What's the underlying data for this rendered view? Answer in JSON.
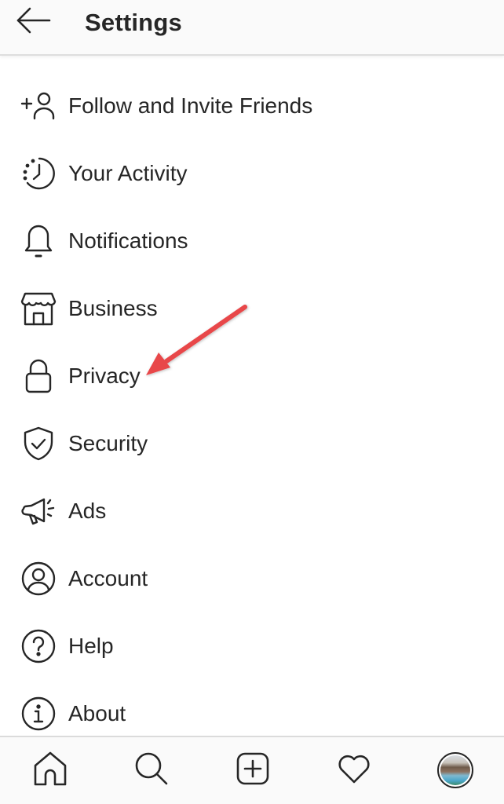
{
  "header": {
    "back_icon": "arrow-left-icon",
    "title": "Settings"
  },
  "menu": {
    "items": [
      {
        "label": "Follow and Invite Friends",
        "icon": "add-person-icon"
      },
      {
        "label": "Your Activity",
        "icon": "activity-clock-icon"
      },
      {
        "label": "Notifications",
        "icon": "bell-icon"
      },
      {
        "label": "Business",
        "icon": "shop-icon"
      },
      {
        "label": "Privacy",
        "icon": "lock-icon"
      },
      {
        "label": "Security",
        "icon": "shield-check-icon"
      },
      {
        "label": "Ads",
        "icon": "megaphone-icon"
      },
      {
        "label": "Account",
        "icon": "account-circle-icon"
      },
      {
        "label": "Help",
        "icon": "help-circle-icon"
      },
      {
        "label": "About",
        "icon": "info-circle-icon"
      }
    ]
  },
  "annotation": {
    "type": "arrow",
    "points_to": "Privacy",
    "color": "#e8474a"
  },
  "bottom_nav": {
    "items": [
      {
        "name": "home",
        "icon": "home-icon"
      },
      {
        "name": "search",
        "icon": "search-icon"
      },
      {
        "name": "new-post",
        "icon": "add-square-icon"
      },
      {
        "name": "activity",
        "icon": "heart-icon"
      },
      {
        "name": "profile",
        "icon": "profile-avatar"
      }
    ]
  },
  "colors": {
    "text": "#262626",
    "header_bg": "#fafafa",
    "divider": "#dbdbdb",
    "arrow": "#e8474a"
  }
}
